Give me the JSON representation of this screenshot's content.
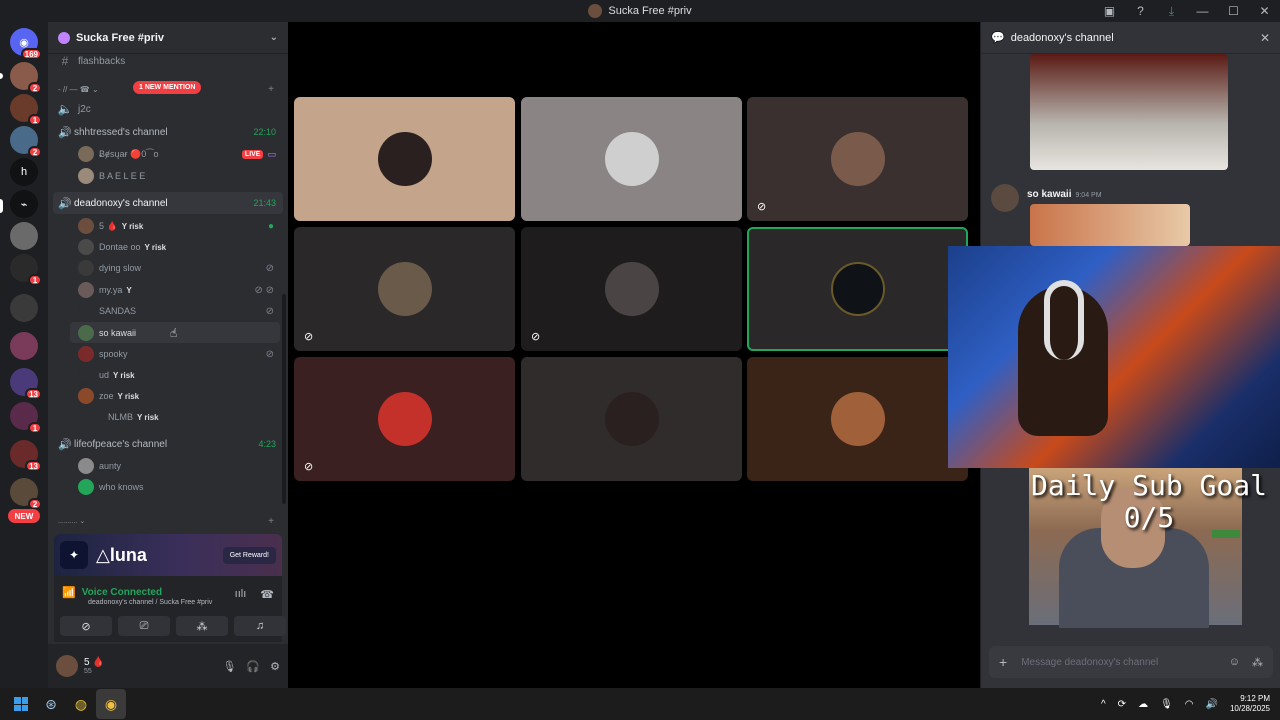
{
  "window": {
    "title": "Sucka Free #priv"
  },
  "guilds": {
    "home_badge": "169",
    "badges": [
      "2",
      "1",
      "2",
      "1",
      "13",
      "1",
      "13",
      "2"
    ],
    "letter_server": "h",
    "new_label": "NEW"
  },
  "sidebar": {
    "server_name": "Sucka Free #priv",
    "mention_label": "1 NEW MENTION",
    "channels": {
      "flashbacks": "flashbacks",
      "category": "- // — ☎ ⌄",
      "j2c": "j2c",
      "shhtressed": {
        "name": "shhtressed's channel",
        "time": "22:10"
      },
      "deadonoxy": {
        "name": "deadonoxy's channel",
        "time": "21:43"
      },
      "lifeofpeace": {
        "name": "lifeofpeace's channel",
        "time": "4:23"
      },
      "bottom_category": ".......... ⌄"
    },
    "shhtressed_users": [
      {
        "name": "Ƀɇsųaɍ 🔴0⁀o",
        "live": "LIVE"
      },
      {
        "name": "B A E L E E"
      }
    ],
    "deadonoxy_users": [
      {
        "name": "5 🩸",
        "tag": "risk"
      },
      {
        "name": "Dontae oo",
        "tag": "risk"
      },
      {
        "name": "dying slow"
      },
      {
        "name": "my.ya",
        "tag": ""
      },
      {
        "name": "SANDAS"
      },
      {
        "name": "so kawaii"
      },
      {
        "name": "spooky"
      },
      {
        "name": "ud",
        "tag": "risk"
      },
      {
        "name": "zoe",
        "tag": "risk"
      },
      {
        "name": "NLMB",
        "tag": "risk"
      }
    ],
    "lifeofpeace_users": [
      {
        "name": "aunty"
      },
      {
        "name": "who knows"
      }
    ]
  },
  "promo": {
    "brand": "luna",
    "button": "Get Reward!"
  },
  "voice": {
    "status": "Voice Connected",
    "location": "deadonoxy's channel / Sucka Free #priv"
  },
  "user_panel": {
    "name": "5 🩸",
    "sub": "55"
  },
  "chat": {
    "header": "deadonoxy's channel",
    "message_author": "so kawaii",
    "message_time": "9:04 PM",
    "input_placeholder": "Message deadonoxy's channel"
  },
  "overlay": {
    "goal_title": "Daily Sub Goal",
    "goal_value": "0/5"
  },
  "taskbar": {
    "time": "9:12 PM",
    "date": "10/28/2025"
  },
  "colors": {
    "online_green": "#23a55a",
    "mention_red": "#f23f43",
    "sidebar_bg": "#2b2d31",
    "chat_bg": "#313338"
  }
}
